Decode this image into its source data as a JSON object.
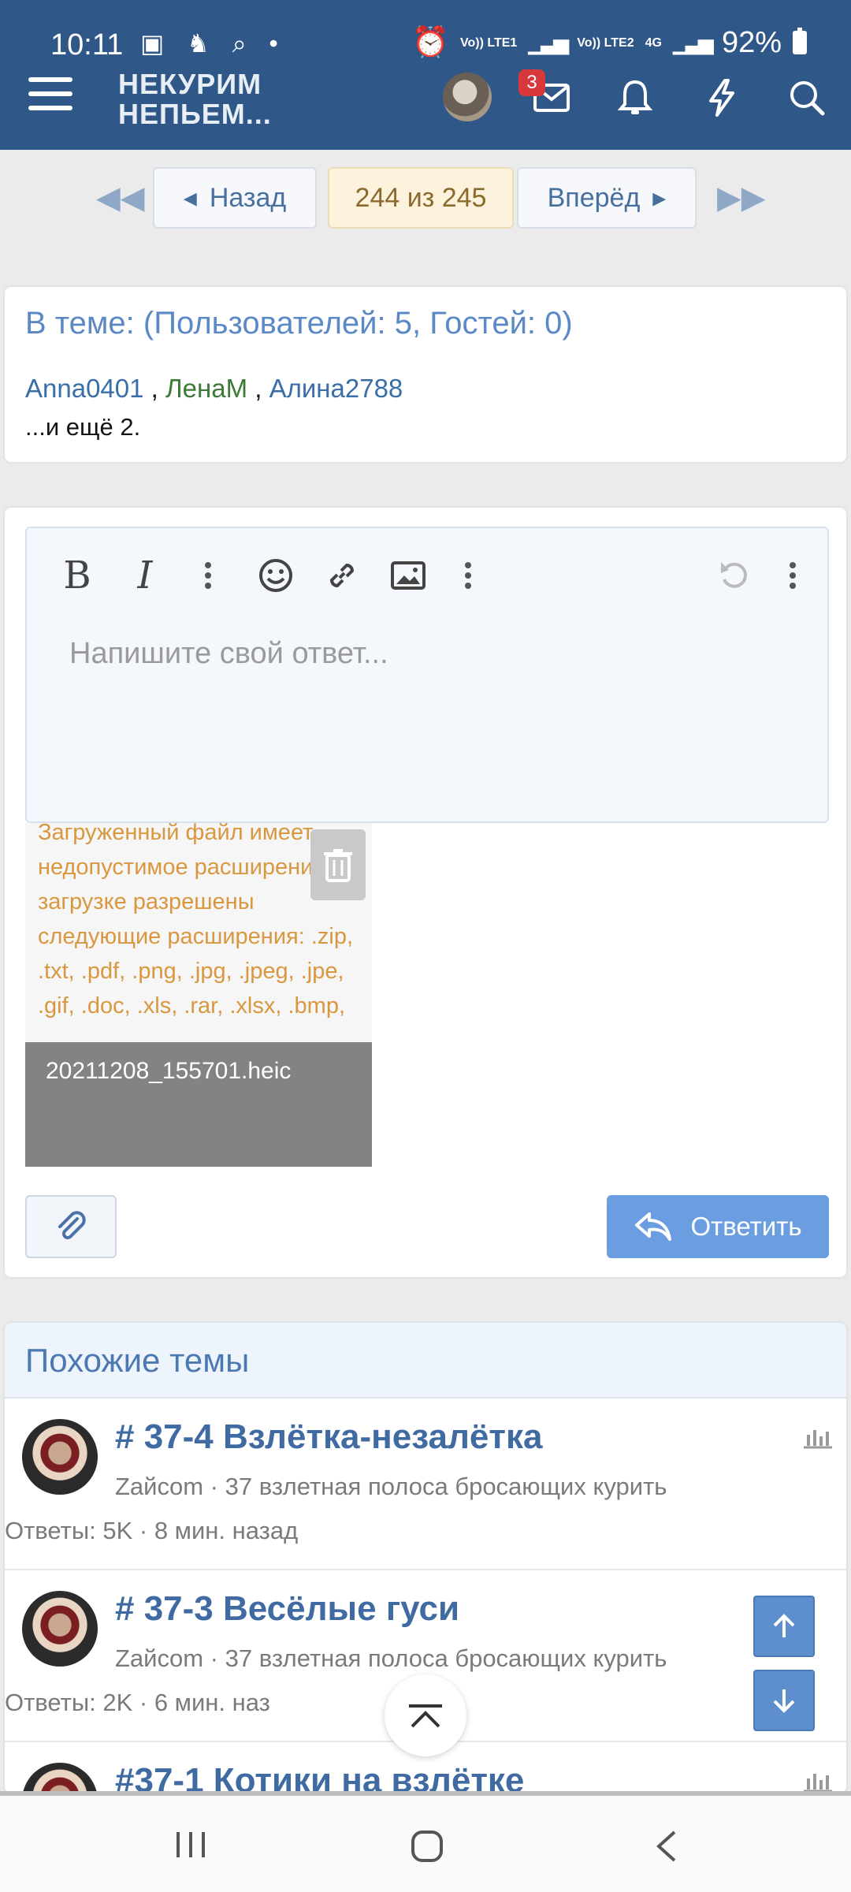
{
  "status_bar": {
    "time": "10:11",
    "net1": "Vo)) LTE1",
    "net2": "Vo)) LTE2",
    "net3": "4G",
    "battery": "92%"
  },
  "header": {
    "logo_line1": "НЕКУРИМ",
    "logo_line2": "НЕПЬЕМ...",
    "messages_badge": "3"
  },
  "pager": {
    "prev_label": "Назад",
    "current": "244 из 245",
    "next_label": "Вперёд"
  },
  "online": {
    "title": "В теме: (Пользователей: 5, Гостей: 0)",
    "users": [
      "Anna0401",
      "ЛенаМ",
      "Алина2788"
    ],
    "sep": " , ",
    "more": "...и ещё 2."
  },
  "editor": {
    "bold": "B",
    "italic": "I",
    "placeholder": "Напишите свой ответ..."
  },
  "attachment": {
    "error": "Загруженный файл имеет недопустимое расширение. К загрузке разрешены следующие расширения: .zip, .txt, .pdf, .png, .jpg, .jpeg, .jpe, .gif, .doc, .xls, .rar, .xlsx, .bmp,",
    "filename": "20211208_155701.heic"
  },
  "reply_button": "Ответить",
  "similar": {
    "title": "Похожие темы",
    "threads": [
      {
        "title": "# 37-4 Взлётка-незалётка",
        "meta": "Zaйcom · 37 взлетная полоса бросающих курить",
        "stats": "Ответы: 5K · 8 мин. назад"
      },
      {
        "title": "# 37-3 Весёлые гуси",
        "meta": "Zaйcom · 37 взлетная полоса бросающих курить",
        "stats": "Ответы: 2K · 6 мин. наз"
      },
      {
        "title": "#37-1 Котики на взлётке",
        "meta": "",
        "stats": ""
      }
    ]
  },
  "colors": {
    "header_bg": "#2f5788",
    "link_blue": "#3f6aa2",
    "accent_button": "#6b9ee0",
    "error_orange": "#d99740"
  }
}
